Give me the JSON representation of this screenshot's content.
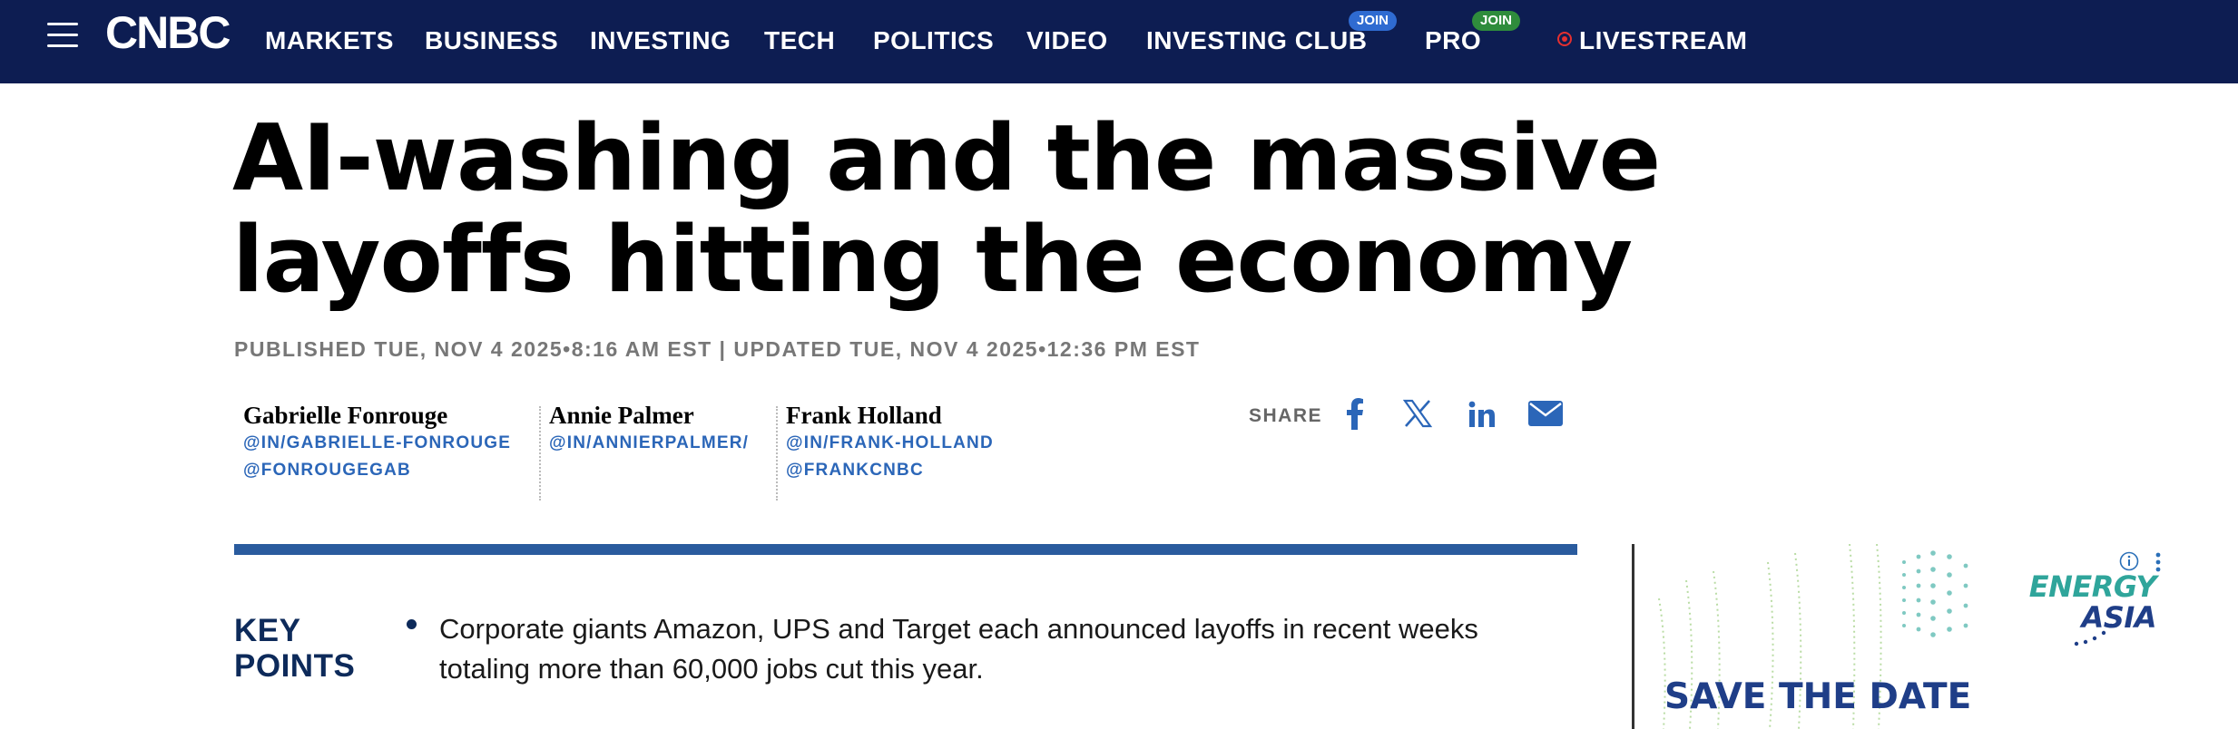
{
  "nav": {
    "logo": "CNBC",
    "items": [
      "MARKETS",
      "BUSINESS",
      "INVESTING",
      "TECH",
      "POLITICS",
      "VIDEO",
      "INVESTING CLUB",
      "PRO"
    ],
    "badges": {
      "investing_club": "JOIN",
      "pro": "JOIN"
    },
    "livestream": "LIVESTREAM",
    "colors": {
      "bar": "#0d1d52",
      "livestream_dot": "#e53030"
    }
  },
  "article": {
    "headline": "AI-washing and the massive layoffs hitting the economy",
    "published": "PUBLISHED TUE, NOV 4 2025•8:16 AM EST | UPDATED TUE, NOV 4 2025•12:36 PM EST",
    "authors": [
      {
        "name": "Gabrielle Fonrouge",
        "links": [
          "@IN/GABRIELLE-FONROUGE",
          "@FONROUGEGAB"
        ]
      },
      {
        "name": "Annie Palmer",
        "links": [
          "@IN/ANNIERPALMER/"
        ]
      },
      {
        "name": "Frank Holland",
        "links": [
          "@IN/FRANK-HOLLAND",
          "@FRANKCNBC"
        ]
      }
    ],
    "share": {
      "label": "SHARE",
      "icons": [
        "facebook-icon",
        "x-icon",
        "linkedin-icon",
        "email-icon"
      ]
    },
    "key_points": {
      "label_line1": "KEY",
      "label_line2": "POINTS",
      "items": [
        "Corporate giants Amazon, UPS and Target each announced layoffs in recent weeks totaling more than 60,000 jobs cut this year."
      ]
    }
  },
  "ad": {
    "brand_line1": "ENERGY",
    "brand_line2": "ASIA",
    "headline": "SAVE THE DATE",
    "icons": [
      "info-icon",
      "more-vertical-icon"
    ]
  }
}
